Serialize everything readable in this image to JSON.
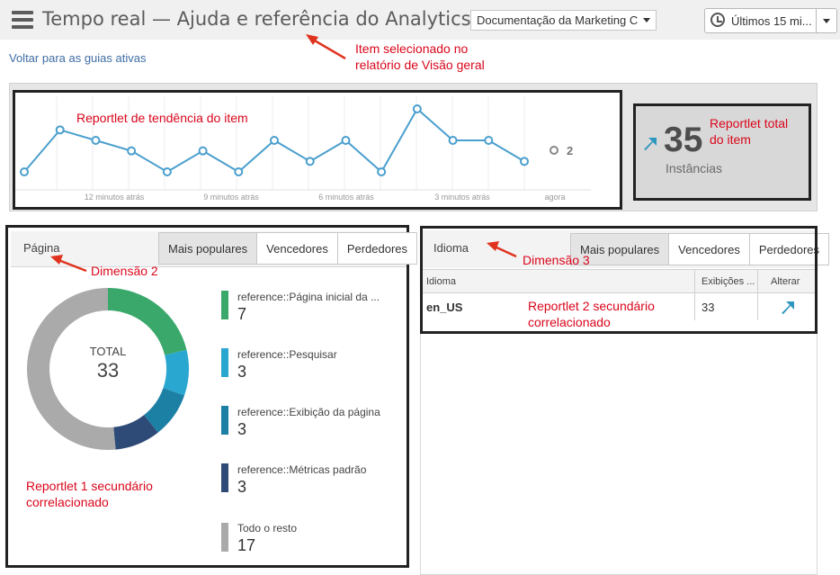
{
  "header": {
    "title": "Tempo real — Ajuda e referência do Analytics",
    "doc_dropdown": "Documentação da Marketing C",
    "time_button": "Últimos 15 mi..."
  },
  "back_link": "Voltar para as guias ativas",
  "annotations": {
    "selected_item": "Item selecionado no relatório de Visão geral",
    "trend_reportlet": "Reportlet de tendência do item",
    "total_reportlet": "Reportlet total do item",
    "dimension2": "Dimensão 2",
    "dimension3": "Dimensão 3",
    "secondary1": "Reportlet 1 secundário correlacionado",
    "secondary2": "Reportlet 2 secundário correlacionado"
  },
  "trend": {
    "values": [
      1,
      3,
      2.5,
      2,
      1,
      2,
      1,
      2.5,
      1.5,
      2.5,
      1,
      4,
      2.5,
      2.5,
      1.5
    ],
    "current_value": "2",
    "x_labels": [
      "12 minutos atrás",
      "9 minutos atrás",
      "6 minutos atrás",
      "3 minutos atrás",
      "agora"
    ],
    "line_color": "#4a9fce"
  },
  "total": {
    "value": "35",
    "label": "Instâncias",
    "trend_icon": "arrow-up-right-icon",
    "accent": "#2e97bf"
  },
  "panel1": {
    "title": "Página",
    "tabs": [
      "Mais populares",
      "Vencedores",
      "Perdedores"
    ],
    "donut_total_label": "TOTAL",
    "donut_total_value": "33",
    "items": [
      {
        "label": "reference::Página inicial da ...",
        "value": "7",
        "color": "#3aa86b"
      },
      {
        "label": "reference::Pesquisar",
        "value": "3",
        "color": "#2aa7d0"
      },
      {
        "label": "reference::Exibição da página",
        "value": "3",
        "color": "#1c7fa4"
      },
      {
        "label": "reference::Métricas padrão",
        "value": "3",
        "color": "#2e4b78"
      },
      {
        "label": "Todo o resto",
        "value": "17",
        "color": "#aaaaaa"
      }
    ]
  },
  "panel2": {
    "title": "Idioma",
    "tabs": [
      "Mais populares",
      "Vencedores",
      "Perdedores"
    ],
    "columns": [
      "Idioma",
      "Exibições ...",
      "Alterar"
    ],
    "rows": [
      {
        "language": "en_US",
        "views": "33",
        "change_icon": "arrow-up-right-icon"
      }
    ]
  }
}
